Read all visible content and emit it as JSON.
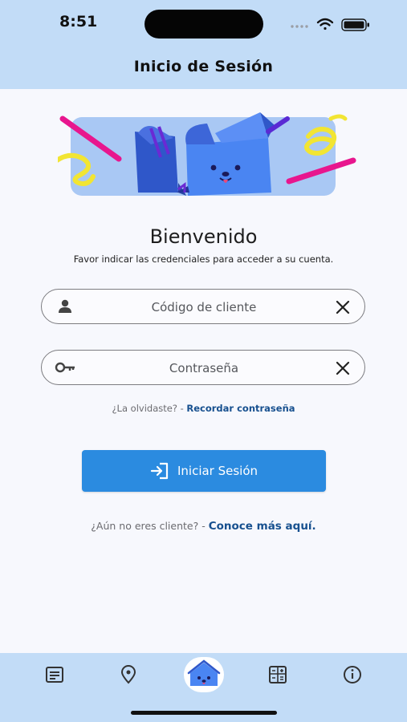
{
  "status_bar": {
    "time": "8:51"
  },
  "header": {
    "title": "Inicio de Sesión"
  },
  "welcome": {
    "title": "Bienvenido",
    "subtitle": "Favor indicar las credenciales para acceder a su cuenta."
  },
  "form": {
    "client_code": {
      "placeholder": "Código de cliente",
      "value": "",
      "icon": "person-icon"
    },
    "password": {
      "placeholder": "Contraseña",
      "value": "",
      "icon": "key-icon"
    },
    "forgot_prompt": "¿La olvidaste? - ",
    "forgot_link": "Recordar contraseña",
    "login_button": "Iniciar Sesión"
  },
  "signup": {
    "prompt": "¿Aún no eres cliente? - ",
    "link": "Conoce más aquí."
  },
  "bottom_nav": {
    "items": [
      "document-icon",
      "location-pin-icon",
      "home-mascot-icon",
      "calculator-icon",
      "info-icon"
    ],
    "active": "home-mascot-icon"
  },
  "colors": {
    "header_bg": "#c2dcf7",
    "page_bg": "#f7f8fd",
    "primary_button": "#2b8be0",
    "link": "#17508f"
  }
}
